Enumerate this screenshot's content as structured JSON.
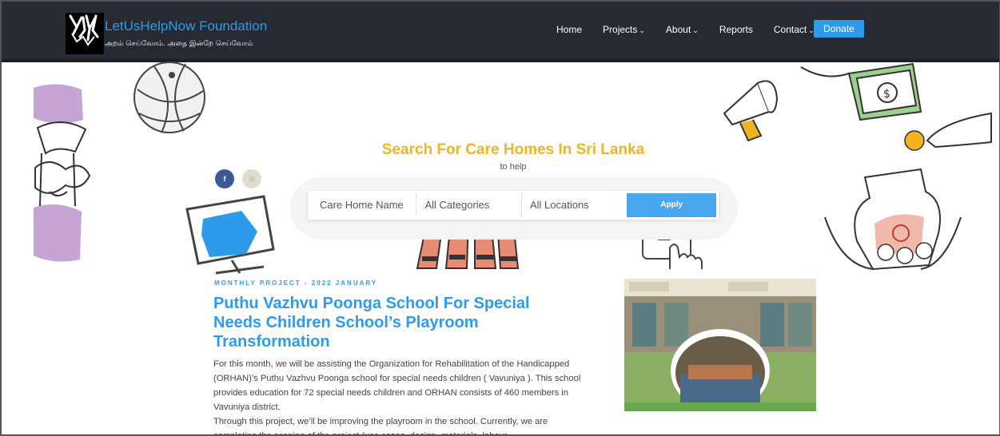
{
  "header": {
    "brand_title": "LetUsHelpNow Foundation",
    "brand_tagline": "அறம் செய்வோம். அதை இன்றே செய்வோம்",
    "nav": [
      {
        "label": "Home",
        "has_dropdown": false
      },
      {
        "label": "Projects",
        "has_dropdown": true
      },
      {
        "label": "About",
        "has_dropdown": true
      },
      {
        "label": "Reports",
        "has_dropdown": false
      },
      {
        "label": "Contact",
        "has_dropdown": true
      }
    ],
    "chevron": "⌄",
    "donate_label": "Donate"
  },
  "social": {
    "facebook_glyph": "f",
    "instagram_glyph": "◎"
  },
  "hero": {
    "title": "Search For Care Homes In Sri Lanka",
    "subtitle": "to help",
    "search": {
      "name_placeholder": "Care Home Name",
      "category_value": "All Categories",
      "location_value": "All Locations",
      "apply_label": "Apply"
    }
  },
  "article": {
    "kicker": "MONTHLY PROJECT - 2022 JANUARY",
    "title": "Puthu Vazhvu Poonga School For Special Needs Children School’s Playroom Transformation",
    "paragraph_1": "For this month, we will be assisting the Organization for Rehabilitation of the Handicapped (ORHAN)’s Puthu Vazhvu Poonga school for special needs children ( Vavuniya ). This school provides education for 72 special needs children and ORHAN consists of 460 members in Vavuniya district.",
    "paragraph_2": "Through this project, we’ll be improving the playroom in the school.  Currently, we are completing the scoping of the project (use cases, design, materials, labour"
  },
  "colors": {
    "header_bg": "#262a33",
    "brand_blue": "#2e9bea",
    "hero_title": "#f0b323",
    "apply_button": "#4aa8ef",
    "facebook": "#3b5998",
    "instagram": "#e0ddd3"
  },
  "icons": [
    "logo-icon",
    "facebook-icon",
    "instagram-icon",
    "chevron-down-icon"
  ]
}
